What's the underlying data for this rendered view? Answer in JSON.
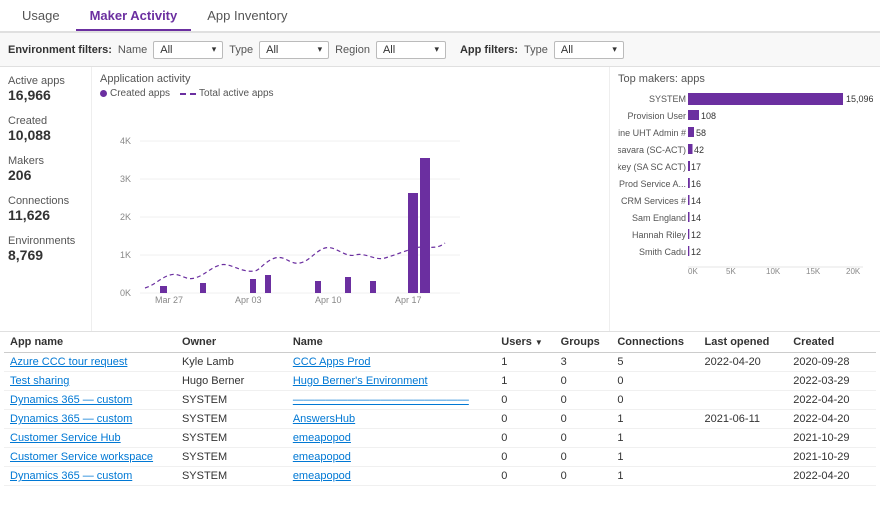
{
  "tabs": [
    {
      "label": "Usage",
      "active": false
    },
    {
      "label": "Maker Activity",
      "active": true
    },
    {
      "label": "App Inventory",
      "active": false
    }
  ],
  "filters": {
    "environment_label": "Environment filters:",
    "app_label": "App filters:",
    "name": {
      "label": "Name",
      "value": "All"
    },
    "type": {
      "label": "Type",
      "value": "All"
    },
    "region": {
      "label": "Region",
      "value": "All"
    },
    "app_type": {
      "label": "Type",
      "value": "All"
    }
  },
  "stats": [
    {
      "label": "Active apps",
      "value": "16,966"
    },
    {
      "label": "Created",
      "value": "10,088"
    },
    {
      "label": "Makers",
      "value": "206"
    },
    {
      "label": "Connections",
      "value": "11,626"
    },
    {
      "label": "Environments",
      "value": "8,769"
    }
  ],
  "chart": {
    "title": "Application activity",
    "legend_created": "Created apps",
    "legend_total": "Total active apps",
    "x_labels": [
      "Mar 27",
      "Apr 03",
      "Apr 10",
      "Apr 17"
    ],
    "y_labels": [
      "0K",
      "1K",
      "2K",
      "3K",
      "4K"
    ]
  },
  "top_makers": {
    "title": "Top makers: apps",
    "items": [
      {
        "name": "SYSTEM",
        "value": 15096
      },
      {
        "name": "Provision User",
        "value": 108
      },
      {
        "name": "CRM Online UHT Admin #",
        "value": 58
      },
      {
        "name": "Sriderr Kasavara (SC-ACT)",
        "value": 42
      },
      {
        "name": "Mike Hickey (SA SC ACT)",
        "value": 17
      },
      {
        "name": "OCP CRM Prod Service A...",
        "value": 16
      },
      {
        "name": "CRM Services #",
        "value": 14
      },
      {
        "name": "Sam England",
        "value": 14
      },
      {
        "name": "Hannah Riley",
        "value": 12
      },
      {
        "name": "Smith Cadu",
        "value": 12
      }
    ],
    "x_labels": [
      "0K",
      "5K",
      "10K",
      "15K",
      "20K"
    ],
    "max_value": 20000
  },
  "table": {
    "columns": [
      {
        "label": "App name",
        "key": "app_name"
      },
      {
        "label": "Owner",
        "key": "owner"
      },
      {
        "label": "Name",
        "key": "name"
      },
      {
        "label": "Users",
        "key": "users",
        "sortable": true
      },
      {
        "label": "Groups",
        "key": "groups"
      },
      {
        "label": "Connections",
        "key": "connections"
      },
      {
        "label": "Last opened",
        "key": "last_opened"
      },
      {
        "label": "Created",
        "key": "created"
      }
    ],
    "rows": [
      {
        "app_name": "Azure CCC tour request",
        "owner": "Kyle Lamb",
        "name": "CCC Apps Prod",
        "users": 1,
        "groups": 3,
        "connections": 5,
        "last_opened": "2022-04-20",
        "created": "2020-09-28"
      },
      {
        "app_name": "Test sharing",
        "owner": "Hugo Berner",
        "name": "Hugo Berner's Environment",
        "users": 1,
        "groups": 0,
        "connections": 0,
        "last_opened": "",
        "created": "2022-03-29"
      },
      {
        "app_name": "Dynamics 365 — custom",
        "owner": "SYSTEM",
        "name": "————————————————",
        "users": 0,
        "groups": 0,
        "connections": 0,
        "last_opened": "",
        "created": "2022-04-20"
      },
      {
        "app_name": "Dynamics 365 — custom",
        "owner": "SYSTEM",
        "name": "AnswersHub",
        "users": 0,
        "groups": 0,
        "connections": 1,
        "last_opened": "2021-06-11",
        "created": "2022-04-20"
      },
      {
        "app_name": "Customer Service Hub",
        "owner": "SYSTEM",
        "name": "emeapopod",
        "users": 0,
        "groups": 0,
        "connections": 1,
        "last_opened": "",
        "created": "2021-10-29"
      },
      {
        "app_name": "Customer Service workspace",
        "owner": "SYSTEM",
        "name": "emeapopod",
        "users": 0,
        "groups": 0,
        "connections": 1,
        "last_opened": "",
        "created": "2021-10-29"
      },
      {
        "app_name": "Dynamics 365 — custom",
        "owner": "SYSTEM",
        "name": "emeapopod",
        "users": 0,
        "groups": 0,
        "connections": 1,
        "last_opened": "",
        "created": "2022-04-20"
      }
    ]
  }
}
